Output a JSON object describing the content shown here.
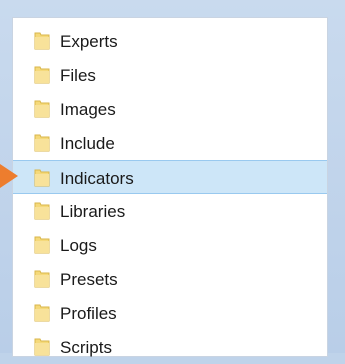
{
  "folders": [
    {
      "label": "Experts",
      "icon": "folder-icon",
      "selected": false
    },
    {
      "label": "Files",
      "icon": "folder-icon",
      "selected": false
    },
    {
      "label": "Images",
      "icon": "folder-icon",
      "selected": false
    },
    {
      "label": "Include",
      "icon": "folder-icon",
      "selected": false
    },
    {
      "label": "Indicators",
      "icon": "folder-icon",
      "selected": true
    },
    {
      "label": "Libraries",
      "icon": "folder-icon",
      "selected": false
    },
    {
      "label": "Logs",
      "icon": "folder-icon",
      "selected": false
    },
    {
      "label": "Presets",
      "icon": "folder-icon",
      "selected": false
    },
    {
      "label": "Profiles",
      "icon": "folder-icon",
      "selected": false
    },
    {
      "label": "Scripts",
      "icon": "folder-icon",
      "selected": false
    }
  ],
  "colors": {
    "pointer_arrow": "#ed7d2e",
    "selection": "#cde6f8",
    "folder": "#f5d97a"
  }
}
